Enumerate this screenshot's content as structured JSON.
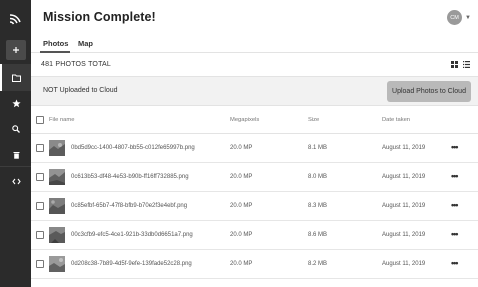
{
  "header": {
    "title": "Mission Complete!",
    "avatar_initials": "CM"
  },
  "tabs": [
    {
      "label": "Photos",
      "active": true
    },
    {
      "label": "Map",
      "active": false
    }
  ],
  "summary": {
    "count_text": "481 PHOTOS TOTAL"
  },
  "banner": {
    "message": "NOT Uploaded to Cloud",
    "upload_button": "Upload Photos to Cloud"
  },
  "table": {
    "headers": {
      "file_name": "File name",
      "megapixels": "Megapixels",
      "size": "Size",
      "date_taken": "Date taken"
    },
    "rows": [
      {
        "name": "0bd5d9cc-1400-4807-bb55-c012fe65997b.png",
        "mp": "20.0 MP",
        "size": "8.1 MB",
        "date": "August 11, 2019"
      },
      {
        "name": "0c613b53-df48-4e53-b90b-ff16ff732885.png",
        "mp": "20.0 MP",
        "size": "8.0 MB",
        "date": "August 11, 2019"
      },
      {
        "name": "0c85efbf-65b7-47f8-bfb9-b70e2f3e4ebf.png",
        "mp": "20.0 MP",
        "size": "8.3 MB",
        "date": "August 11, 2019"
      },
      {
        "name": "00c3cfb9-efc5-4ce1-921b-33db0d6651a7.png",
        "mp": "20.0 MP",
        "size": "8.6 MB",
        "date": "August 11, 2019"
      },
      {
        "name": "0d208c38-7b89-4d5f-9efe-139fade52c28.png",
        "mp": "20.0 MP",
        "size": "8.2 MB",
        "date": "August 11, 2019"
      }
    ],
    "row_menu": "•••"
  },
  "colors": {
    "rail_bg": "#2b2b2b",
    "banner_bg": "#f2f2f2",
    "upload_button_bg": "#b9b9b9"
  },
  "icons": {
    "rail": [
      "logo-icon",
      "add-icon",
      "folder-icon",
      "star-icon",
      "search-icon",
      "trash-icon",
      "code-icon"
    ],
    "view": [
      "grid-view-icon",
      "list-view-icon"
    ]
  }
}
